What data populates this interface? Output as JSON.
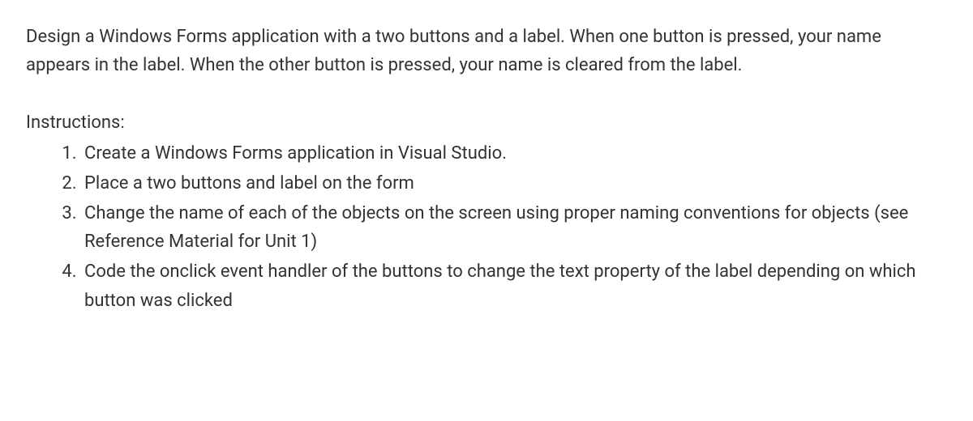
{
  "intro": "Design a Windows Forms application with a two buttons and a label. When one button is pressed, your name appears in the label. When the other button is pressed, your name is cleared from the label.",
  "instructions": {
    "heading": "Instructions:",
    "items": [
      "Create a Windows Forms application in Visual Studio.",
      "Place a two buttons and label on the form",
      "Change the name of each of the objects on the screen using proper naming conventions for objects (see Reference Material for Unit 1)",
      "Code the onclick event handler of the buttons to change the text property of the label depending on which button was clicked"
    ]
  }
}
